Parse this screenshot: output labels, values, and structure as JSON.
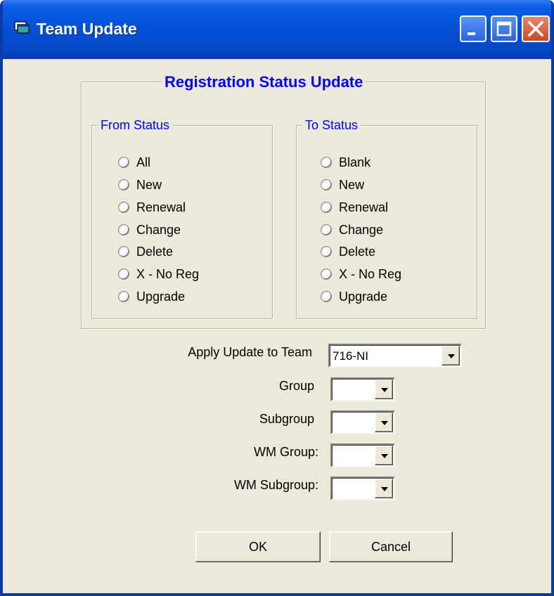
{
  "window": {
    "title": "Team Update",
    "icons": {
      "app": "app-window-icon",
      "minimize": "minimize-icon",
      "maximize": "maximize-icon",
      "close": "close-icon"
    },
    "colors": {
      "titlebar": "#0450d6",
      "body": "#ece9d8",
      "legend": "#0000ff",
      "close": "#c74a26"
    }
  },
  "registration": {
    "title": "Registration Status Update",
    "from": {
      "title": "From Status",
      "options": [
        "All",
        "New",
        "Renewal",
        "Change",
        "Delete",
        "X - No Reg",
        "Upgrade"
      ]
    },
    "to": {
      "title": "To Status",
      "options": [
        "Blank",
        "New",
        "Renewal",
        "Change",
        "Delete",
        "X - No Reg",
        "Upgrade"
      ]
    }
  },
  "fields": {
    "team": {
      "label": "Apply Update to Team",
      "value": "716-NI"
    },
    "group": {
      "label": "Group",
      "value": ""
    },
    "subgroup": {
      "label": "Subgroup",
      "value": ""
    },
    "wm_group": {
      "label": "WM Group:",
      "value": ""
    },
    "wm_subgroup": {
      "label": "WM Subgroup:",
      "value": ""
    }
  },
  "buttons": {
    "ok": "OK",
    "cancel": "Cancel"
  }
}
